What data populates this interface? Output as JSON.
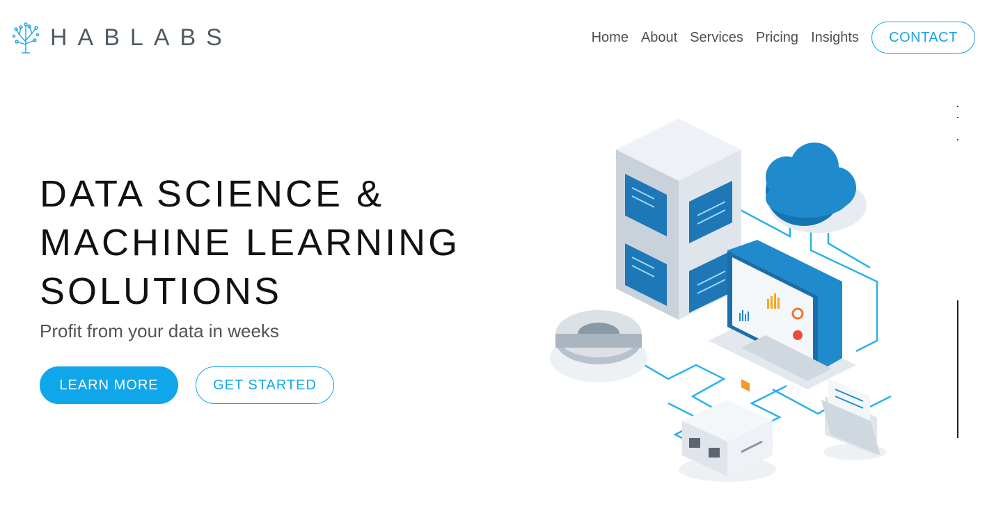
{
  "brand": {
    "name": "HABLABS",
    "accent_color": "#10a6ea"
  },
  "nav": {
    "items": [
      {
        "label": "Home"
      },
      {
        "label": "About"
      },
      {
        "label": "Services"
      },
      {
        "label": "Pricing"
      },
      {
        "label": "Insights"
      }
    ],
    "contact_label": "CONTACT"
  },
  "hero": {
    "title_lines": [
      "DATA SCIENCE &",
      "MACHINE LEARNING",
      "SOLUTIONS"
    ],
    "subtitle": "Profit from your data in weeks",
    "primary_button": "LEARN MORE",
    "secondary_button": "GET STARTED"
  },
  "illustration": {
    "icons": [
      "server-rack-icon",
      "cloud-icon",
      "laptop-dashboard-icon",
      "gear-icon",
      "storage-box-icon",
      "folder-icon"
    ]
  }
}
